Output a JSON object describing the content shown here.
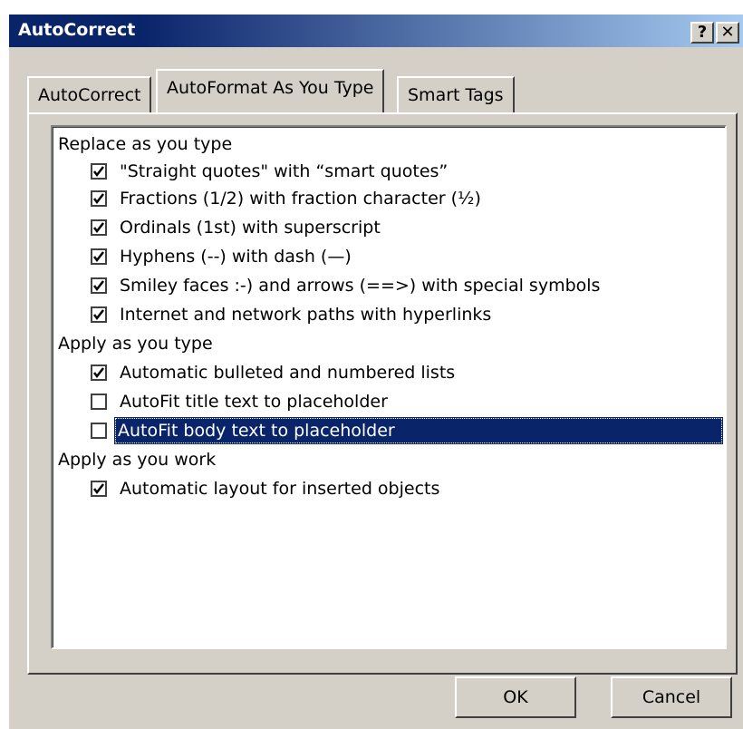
{
  "window": {
    "title": "AutoCorrect",
    "help_label": "?",
    "close_label": "✕"
  },
  "tabs": [
    {
      "label": "AutoCorrect",
      "active": false
    },
    {
      "label": "AutoFormat As You Type",
      "active": true
    },
    {
      "label": "Smart Tags",
      "active": false
    }
  ],
  "sections": [
    {
      "header": "Replace as you type",
      "options": [
        {
          "label": "\"Straight quotes\" with “smart quotes”",
          "checked": true
        },
        {
          "label": "Fractions (1/2) with fraction character (½)",
          "checked": true
        },
        {
          "label": "Ordinals (1st) with superscript",
          "checked": true
        },
        {
          "label": "Hyphens (--) with dash (—)",
          "checked": true
        },
        {
          "label": "Smiley faces :-) and arrows (==>) with special symbols",
          "checked": true
        },
        {
          "label": "Internet and network paths with hyperlinks",
          "checked": true
        }
      ]
    },
    {
      "header": "Apply as you type",
      "options": [
        {
          "label": "Automatic bulleted and numbered lists",
          "checked": true
        },
        {
          "label": "AutoFit title text to placeholder",
          "checked": false
        },
        {
          "label": "AutoFit body text to placeholder",
          "checked": false,
          "selected": true
        }
      ]
    },
    {
      "header": "Apply as you work",
      "options": [
        {
          "label": "Automatic layout for inserted objects",
          "checked": true
        }
      ]
    }
  ],
  "buttons": {
    "ok_label": "OK",
    "cancel_label": "Cancel"
  },
  "colors": {
    "dialog_face": "#d4d0c8",
    "title_gradient_start": "#0a246a",
    "title_gradient_end": "#a6caf0",
    "selection": "#0a246a"
  }
}
